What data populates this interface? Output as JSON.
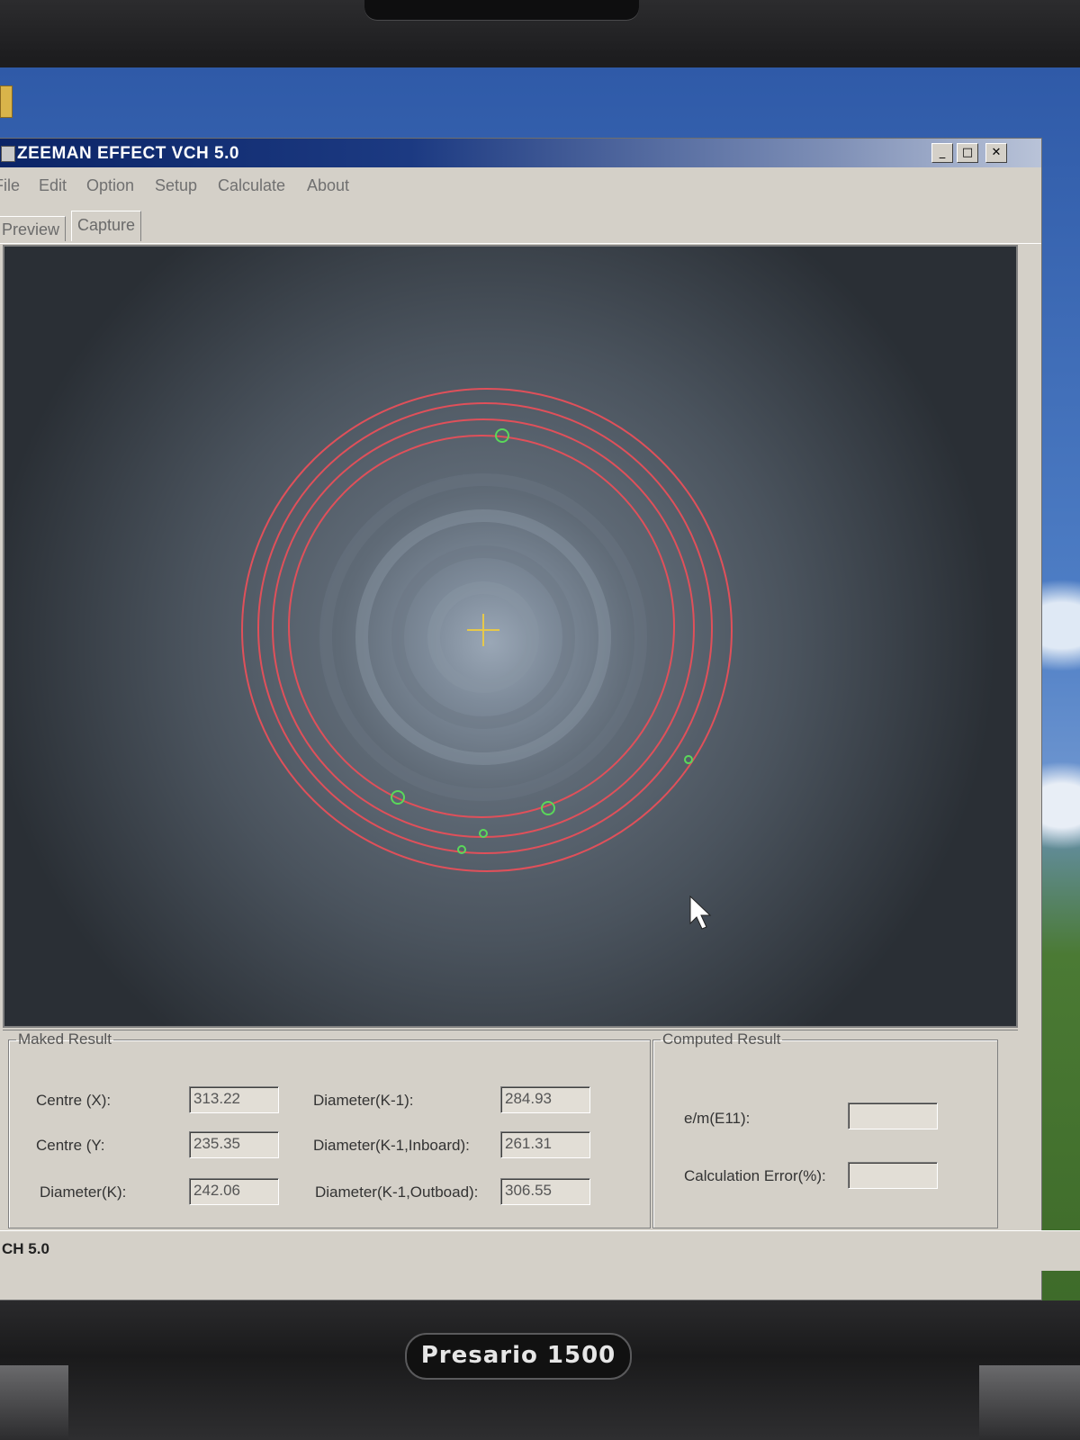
{
  "window": {
    "title": "ZEEMAN EFFECT VCH 5.0",
    "controls": {
      "minimize": "_",
      "maximize": "□",
      "close": "✕"
    }
  },
  "menu": [
    "File",
    "Edit",
    "Option",
    "Setup",
    "Calculate",
    "About"
  ],
  "tabs": [
    {
      "label": "Preview",
      "active": false
    },
    {
      "label": "Capture",
      "active": true
    }
  ],
  "capture": {
    "ring_color": "#e0505a",
    "marker_color": "#5ad85a",
    "crosshair_color": "#e6c84a"
  },
  "maked_result": {
    "legend": "Maked Result",
    "centre_x_label": "Centre (X):",
    "centre_x_value": "313.22",
    "centre_y_label": "Centre (Y:",
    "centre_y_value": "235.35",
    "diameter_k_label": "Diameter(K):",
    "diameter_k_value": "242.06",
    "diameter_k1_label": "Diameter(K-1):",
    "diameter_k1_value": "284.93",
    "diameter_k1_inboard_label": "Diameter(K-1,Inboard):",
    "diameter_k1_inboard_value": "261.31",
    "diameter_k1_outboard_label": "Diameter(K-1,Outboad):",
    "diameter_k1_outboard_value": "306.55"
  },
  "computed_result": {
    "legend": "Computed Result",
    "em_label": "e/m(E11):",
    "em_value": "",
    "error_label": "Calculation Error(%):",
    "error_value": ""
  },
  "statusbar": {
    "text": "CH 5.0"
  },
  "laptop": {
    "brand": "Presario 1500"
  }
}
